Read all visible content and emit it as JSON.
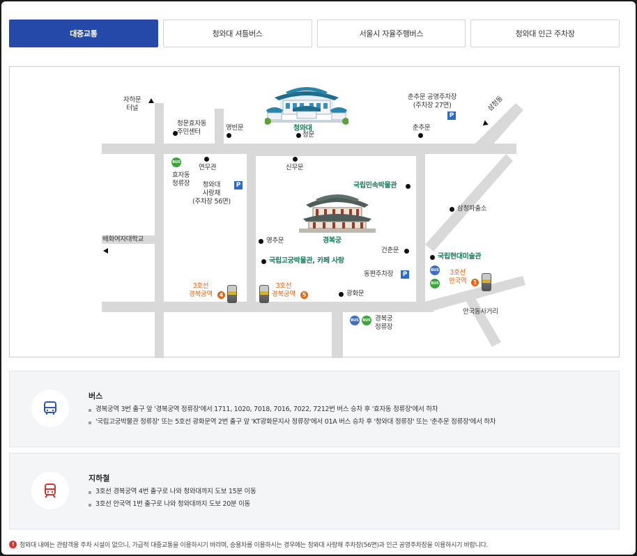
{
  "tabs": [
    {
      "label": "대중교통",
      "active": true
    },
    {
      "label": "청와대 셔틀버스",
      "active": false
    },
    {
      "label": "서울시 자율주행버스",
      "active": false
    },
    {
      "label": "청와대 인근 주차장",
      "active": false
    }
  ],
  "map": {
    "landmarks": {
      "cheongwadae": "청와대",
      "gyeongbokgung": "경복궁",
      "folk_museum": "국립민속박물관",
      "palace_museum": "국립고궁박물관, 카페 사랑",
      "mmca": "국립현대미술관"
    },
    "labels": {
      "jahamun_tunnel_1": "자하문",
      "jahamun_tunnel_2": "터널",
      "community_center_1": "청운효자동",
      "community_center_2": "주민센터",
      "yeongbinmun": "영빈문",
      "jeongmun": "정문",
      "chunchumun_parking_1": "춘추문 공영주차장",
      "chunchumun_parking_2": "(주차장 27면)",
      "chunchumun": "춘추문",
      "samcheongdong": "삼청동",
      "yeonmugwan": "연무관",
      "sinmumun": "신무문",
      "hyojadong_stop_1": "효자동",
      "hyojadong_stop_2": "정류장",
      "cw_parking_1": "청와대",
      "cw_parking_2": "사랑채",
      "cw_parking_3": "(주차장 56면)",
      "police_box": "삼청파출소",
      "ewha_univ": "배화여자대학교",
      "yeongchumun": "영추문",
      "geonchunmun": "건춘문",
      "east_parking": "동편주차장",
      "gwanghwamun": "광화문",
      "anguk_intersection": "안국동사거리",
      "gb_stop_1": "경복궁",
      "gb_stop_2": "정류장",
      "gb_station_line": "3호선",
      "gb_station_name": "경복궁역",
      "gb_station_exit4": "4",
      "gb_station_exit5": "5",
      "anguk_line": "3호선",
      "anguk_name": "안국역",
      "anguk_exit": "1",
      "bus": "BUS",
      "parking": "P"
    }
  },
  "bus_panel": {
    "title": "버스",
    "items": [
      "경복궁역 3번 출구 앞 '경복궁역 정류장'에서 1711, 1020, 7018, 7016, 7022, 7212번 버스 승차 후 '효자동 정류장'에서 하차",
      "'국립고궁박물관 정류장' 또는 5호선 광화문역 2번 출구 앞 'KT광화문지사 정류장'에서 01A 버스 승차 후 '청와대 정류장' 또는 '춘추문 정류장'에서 하차"
    ]
  },
  "subway_panel": {
    "title": "지하철",
    "items": [
      "3호선 경복궁역 4번 출구로 나와 청와대까지 도보 15분 이동",
      "3호선 안국역 1번 출구로 나와 청와대까지 도보 20분 이동"
    ]
  },
  "notice": {
    "icon": "!",
    "text": "청와대 내에는 관람객용 주차 시설이 없으니, 가급적 대중교통을 이용하시기 바라며, 승용차를 이용하시는 경우에는 청와대 사랑채 주차장(56면)과 인근 공영주차장을 이용하시기 바랍니다."
  },
  "colors": {
    "active_tab": "#2549a8",
    "road": "#d9d9d9",
    "landmark_green": "#147a5a",
    "subway_orange": "#e8630f",
    "bus_icon": "#2d58b8",
    "subway_icon": "#d8332f"
  }
}
